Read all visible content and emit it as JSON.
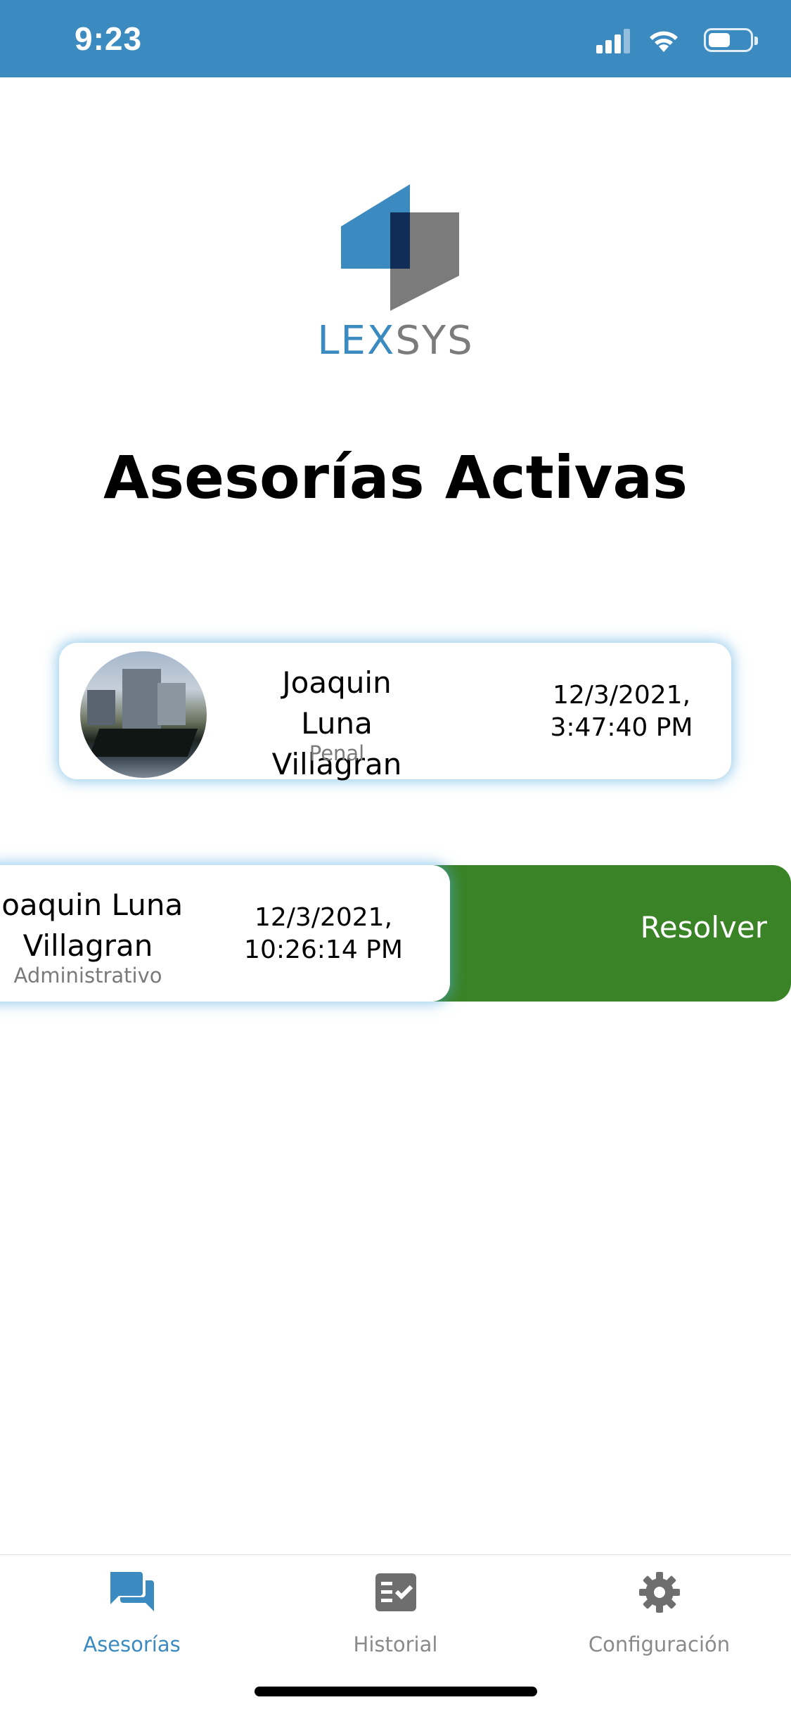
{
  "status_bar": {
    "time": "9:23",
    "background": "#3c8bc0"
  },
  "logo": {
    "text_part1": "LEX",
    "text_part2": "SYS",
    "color_primary": "#3c8bc0",
    "color_secondary": "#7b7b7b"
  },
  "page": {
    "title": "Asesorías Activas"
  },
  "cards": [
    {
      "name_line1": "Joaquin Luna",
      "name_line2": "Villagran",
      "category": "Penal",
      "date_line1": "12/3/2021,",
      "date_line2": "3:47:40 PM",
      "has_avatar": true
    },
    {
      "name_line1": "Joaquin Luna",
      "name_line2": "Villagran",
      "category": "Administrativo",
      "date_line1": "12/3/2021,",
      "date_line2": "10:26:14 PM",
      "swipe_action": "Resolver",
      "swipe_action_color": "#3a8326"
    }
  ],
  "tab_bar": {
    "tabs": [
      {
        "label": "Asesorías",
        "icon": "chat-bubbles-icon",
        "active": true
      },
      {
        "label": "Historial",
        "icon": "checklist-icon",
        "active": false
      },
      {
        "label": "Configuración",
        "icon": "gear-icon",
        "active": false
      }
    ],
    "active_color": "#3c8bc0",
    "inactive_color": "#8a8a8a"
  }
}
